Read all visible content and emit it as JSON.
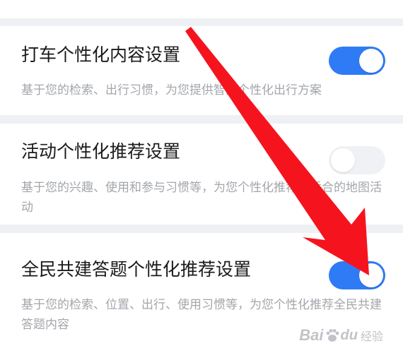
{
  "settings": [
    {
      "title": "打车个性化内容设置",
      "description": "基于您的检索、出行习惯，为您提供智能个性化出行方案",
      "enabled": true
    },
    {
      "title": "活动个性化推荐设置",
      "description": "基于您的兴趣、使用和参与习惯等，为您个性化推荐更适合的地图活动",
      "enabled": false
    },
    {
      "title": "全民共建答题个性化推荐设置",
      "description": "基于您的检索、位置、出行、使用习惯等，为您个性化推荐全民共建答题内容",
      "enabled": true
    }
  ],
  "colors": {
    "toggle_on": "#2f7bf5",
    "toggle_off": "#f0f1f4",
    "annotation_arrow": "#f5141e"
  },
  "icons": {
    "annotation": "red-arrow-icon",
    "watermark_paw": "baidu-paw-icon"
  },
  "watermark": {
    "left": "Bai",
    "right": "经验",
    "sub": "du"
  }
}
